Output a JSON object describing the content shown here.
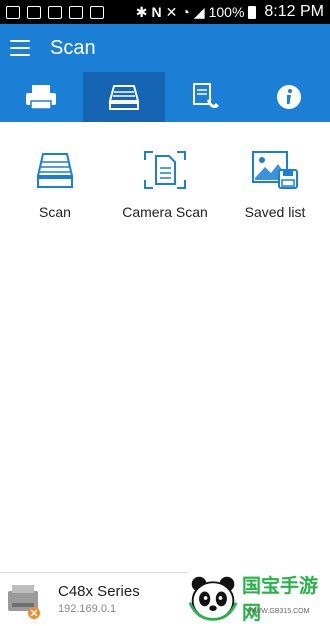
{
  "status": {
    "battery": "100%",
    "time": "8:12 PM"
  },
  "app": {
    "title": "Scan"
  },
  "tabs": [
    {
      "name": "print",
      "icon": "printer-icon"
    },
    {
      "name": "scan",
      "icon": "scanner-icon",
      "active": true
    },
    {
      "name": "fax",
      "icon": "fax-phone-icon"
    },
    {
      "name": "info",
      "icon": "info-icon"
    }
  ],
  "grid": [
    {
      "label": "Scan",
      "icon": "flatbed-scanner-icon"
    },
    {
      "label": "Camera Scan",
      "icon": "camera-scan-icon"
    },
    {
      "label": "Saved list",
      "icon": "saved-list-icon"
    }
  ],
  "device": {
    "name": "C48x Series",
    "ip": "192.169.0.1"
  },
  "watermark": {
    "brand": "国宝手游网",
    "url": "WWW.GB315.COM"
  },
  "colors": {
    "primary": "#1b7fd6",
    "active_tab": "#1565b3",
    "icon_blue": "#1b7fd6"
  }
}
